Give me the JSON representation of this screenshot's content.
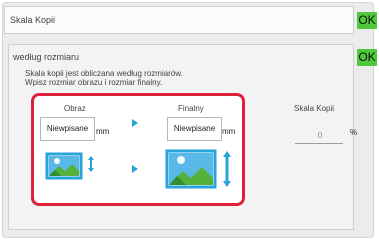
{
  "top_bar": {
    "title": "Skala Kopii",
    "ok_label": "OK"
  },
  "section": {
    "title": "według rozmiaru",
    "ok_label": "OK"
  },
  "description": {
    "line1": "Skala kopii jest obliczana według rozmiarów.",
    "line2": "Wpisz rozmiar obrazu i rozmiar finalny."
  },
  "original": {
    "label": "Obraz",
    "value": "Niewpisane",
    "unit": "mm"
  },
  "final": {
    "label": "Finalny",
    "value": "Niewpisane",
    "unit": "mm"
  },
  "scale": {
    "label": "Skala Kopii",
    "value": "0",
    "unit": "%"
  },
  "colors": {
    "ok": "#4fc83a",
    "highlight": "#e0203a",
    "arrow": "#27a4d9"
  },
  "icons": [
    "image-icon",
    "resize-arrows-icon",
    "next-arrow-icon"
  ]
}
